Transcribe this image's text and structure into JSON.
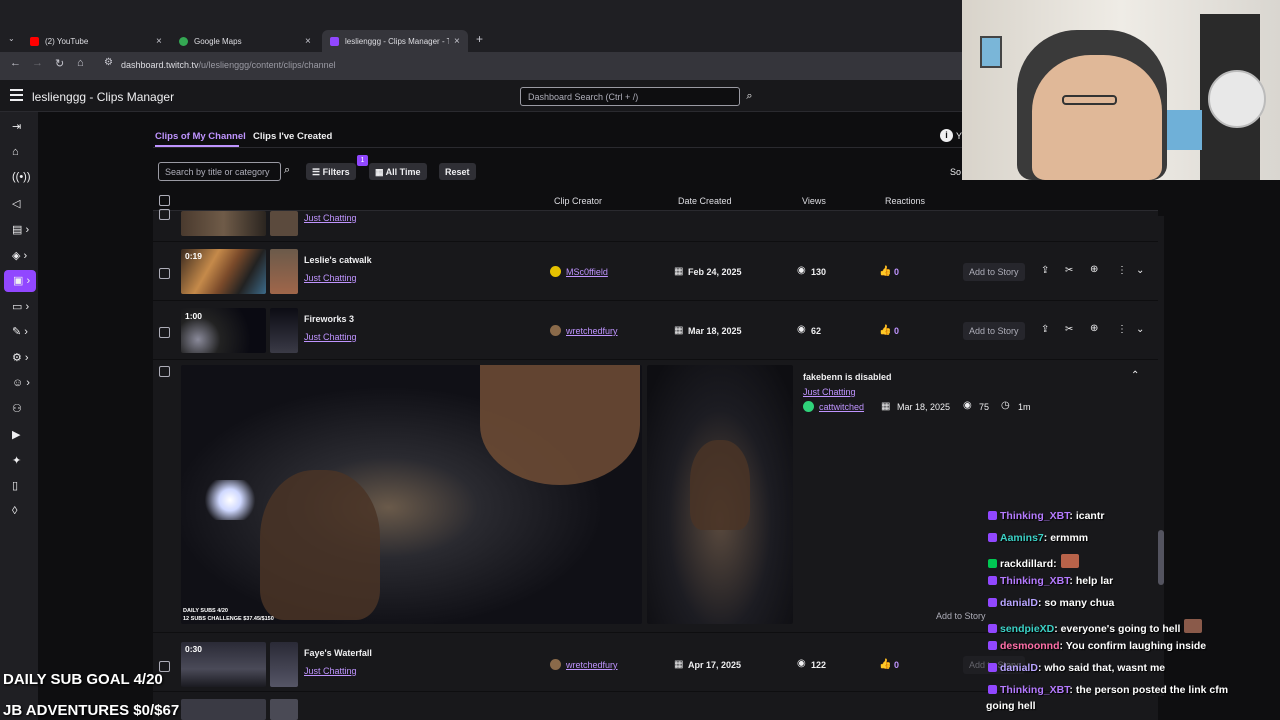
{
  "browser": {
    "tabs": [
      {
        "label": "(2) YouTube",
        "icon": "youtube-icon"
      },
      {
        "label": "Google Maps",
        "icon": "maps-icon"
      },
      {
        "label": "leslienggg - Clips Manager - Tw",
        "icon": "twitch-icon"
      }
    ],
    "url_host": "dashboard.twitch.tv",
    "url_path": "/u/leslienggg/content/clips/channel"
  },
  "header": {
    "title": "leslienggg - Clips Manager",
    "search_placeholder": "Dashboard Search (Ctrl + /)"
  },
  "subtabs": [
    "Clips of My Channel",
    "Clips I've Created"
  ],
  "filters": {
    "search_placeholder": "Search by title or category",
    "filters_label": "Filters",
    "filters_badge": "1",
    "time_label": "All Time",
    "reset_label": "Reset",
    "info_text": "Y",
    "sort_label": "So"
  },
  "table": {
    "columns": [
      "Clip Creator",
      "Date Created",
      "Views",
      "Reactions"
    ]
  },
  "clips": [
    {
      "category": "Just Chatting"
    },
    {
      "duration": "0:19",
      "title": "Leslie's catwalk",
      "category": "Just Chatting",
      "creator": "MSc0ffield",
      "date": "Feb 24, 2025",
      "views": "130",
      "reactions": "0",
      "story": "Add to Story"
    },
    {
      "duration": "1:00",
      "title": "Fireworks 3",
      "category": "Just Chatting",
      "creator": "wretchedfury",
      "date": "Mar 18, 2025",
      "views": "62",
      "reactions": "0",
      "story": "Add to Story"
    },
    {
      "title": "fakebenn is disabled",
      "category": "Just Chatting",
      "creator": "cattwitched",
      "date": "Mar 18, 2025",
      "views": "75",
      "length": "1m",
      "story": "Add to Story",
      "thumb_caption_1": "DAILY SUBS 4/20",
      "thumb_caption_2": "12 SUBS CHALLENGE $37.45/$150"
    },
    {
      "duration": "0:30",
      "title": "Faye's Waterfall",
      "category": "Just Chatting",
      "creator": "wretchedfury",
      "date": "Apr 17, 2025",
      "views": "122",
      "reactions": "0",
      "story": "Add to Story"
    }
  ],
  "overlay": {
    "sub_goal": "DAILY SUB GOAL 4/20",
    "jb_adventures": "JB ADVENTURES $0/$67",
    "chat": [
      {
        "user": "Thinking_XBT",
        "msg": ": icantr",
        "color": "#b57bff"
      },
      {
        "user": "Aamins7",
        "msg": ": ermmm",
        "color": "#3bd1c6"
      },
      {
        "user": "rackdillard",
        "msg": ":",
        "color": "#ffffff"
      },
      {
        "user": "Thinking_XBT",
        "msg": ": help lar",
        "color": "#b57bff"
      },
      {
        "user": "danialD",
        "msg": ": so many chua",
        "color": "#b8a5ff"
      },
      {
        "user": "sendpieXD",
        "msg": ": everyone's going to hell",
        "color": "#3bd1c6"
      },
      {
        "user": "desmoonnd",
        "msg": ": You confirm laughing inside",
        "color": "#ff6fa8"
      },
      {
        "user": "danialD",
        "msg": ": who said that, wasnt me",
        "color": "#b8a5ff"
      },
      {
        "user": "Thinking_XBT",
        "msg": ": the person posted the link cfm",
        "color": "#b57bff"
      },
      {
        "user": "",
        "msg": "going hell",
        "color": "#ffffff"
      }
    ]
  },
  "colors": {
    "accent": "#9147ff",
    "link": "#bf94ff",
    "background": "#0e0e10",
    "row": "#18181b"
  }
}
